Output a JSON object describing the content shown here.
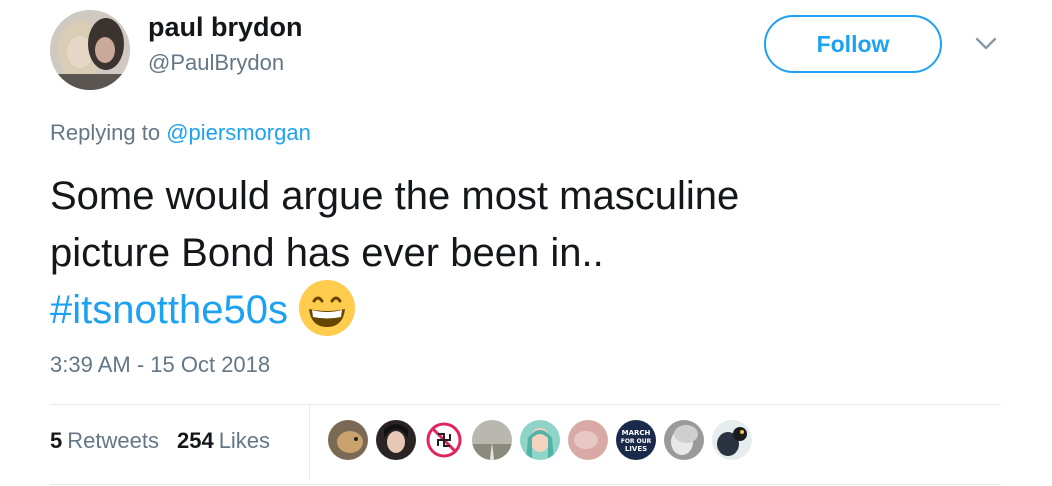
{
  "user": {
    "name": "paul brydon",
    "handle": "@PaulBrydon"
  },
  "follow_label": "Follow",
  "reply": {
    "prefix": "Replying to ",
    "mention": "@piersmorgan"
  },
  "tweet": {
    "line1": "Some would argue the most masculine",
    "line2": "picture Bond has ever been in..",
    "hashtag": "#itsnotthe50s",
    "emoji": "grinning-face-emoji"
  },
  "timestamp": "3:39 AM - 15 Oct 2018",
  "stats": {
    "retweets_count": "5",
    "retweets_label": "Retweets",
    "likes_count": "254",
    "likes_label": "Likes"
  },
  "march_badge": [
    "MARCH",
    "FOR OUR",
    "LIVES"
  ],
  "colors": {
    "accent": "#1da1f2",
    "muted": "#657786",
    "text": "#14171a",
    "divider": "#e6ecf0"
  }
}
